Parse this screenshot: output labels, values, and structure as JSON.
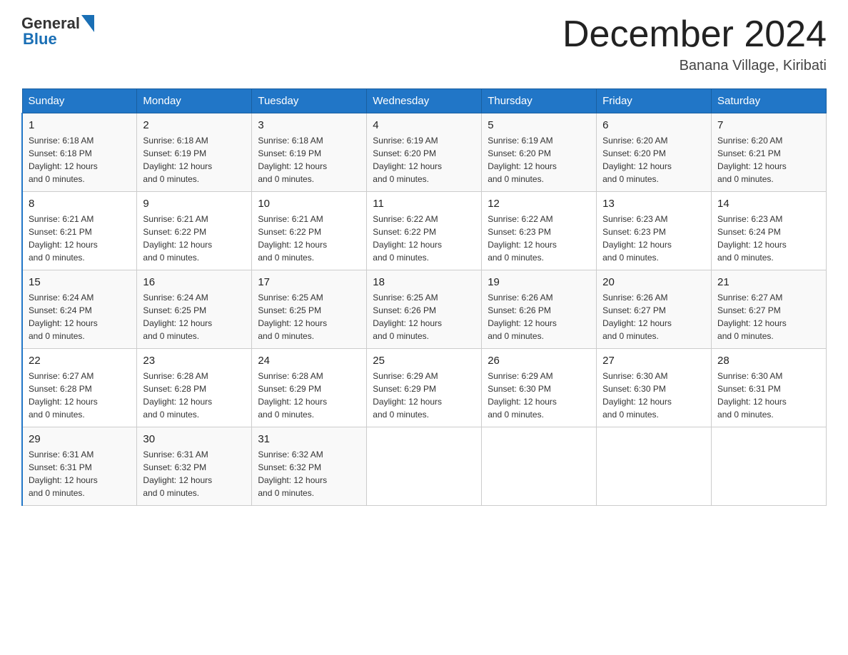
{
  "header": {
    "logo_general": "General",
    "logo_blue": "Blue",
    "month_title": "December 2024",
    "subtitle": "Banana Village, Kiribati"
  },
  "days_of_week": [
    "Sunday",
    "Monday",
    "Tuesday",
    "Wednesday",
    "Thursday",
    "Friday",
    "Saturday"
  ],
  "weeks": [
    [
      {
        "day": "1",
        "sunrise": "6:18 AM",
        "sunset": "6:18 PM",
        "daylight": "12 hours and 0 minutes."
      },
      {
        "day": "2",
        "sunrise": "6:18 AM",
        "sunset": "6:19 PM",
        "daylight": "12 hours and 0 minutes."
      },
      {
        "day": "3",
        "sunrise": "6:18 AM",
        "sunset": "6:19 PM",
        "daylight": "12 hours and 0 minutes."
      },
      {
        "day": "4",
        "sunrise": "6:19 AM",
        "sunset": "6:20 PM",
        "daylight": "12 hours and 0 minutes."
      },
      {
        "day": "5",
        "sunrise": "6:19 AM",
        "sunset": "6:20 PM",
        "daylight": "12 hours and 0 minutes."
      },
      {
        "day": "6",
        "sunrise": "6:20 AM",
        "sunset": "6:20 PM",
        "daylight": "12 hours and 0 minutes."
      },
      {
        "day": "7",
        "sunrise": "6:20 AM",
        "sunset": "6:21 PM",
        "daylight": "12 hours and 0 minutes."
      }
    ],
    [
      {
        "day": "8",
        "sunrise": "6:21 AM",
        "sunset": "6:21 PM",
        "daylight": "12 hours and 0 minutes."
      },
      {
        "day": "9",
        "sunrise": "6:21 AM",
        "sunset": "6:22 PM",
        "daylight": "12 hours and 0 minutes."
      },
      {
        "day": "10",
        "sunrise": "6:21 AM",
        "sunset": "6:22 PM",
        "daylight": "12 hours and 0 minutes."
      },
      {
        "day": "11",
        "sunrise": "6:22 AM",
        "sunset": "6:22 PM",
        "daylight": "12 hours and 0 minutes."
      },
      {
        "day": "12",
        "sunrise": "6:22 AM",
        "sunset": "6:23 PM",
        "daylight": "12 hours and 0 minutes."
      },
      {
        "day": "13",
        "sunrise": "6:23 AM",
        "sunset": "6:23 PM",
        "daylight": "12 hours and 0 minutes."
      },
      {
        "day": "14",
        "sunrise": "6:23 AM",
        "sunset": "6:24 PM",
        "daylight": "12 hours and 0 minutes."
      }
    ],
    [
      {
        "day": "15",
        "sunrise": "6:24 AM",
        "sunset": "6:24 PM",
        "daylight": "12 hours and 0 minutes."
      },
      {
        "day": "16",
        "sunrise": "6:24 AM",
        "sunset": "6:25 PM",
        "daylight": "12 hours and 0 minutes."
      },
      {
        "day": "17",
        "sunrise": "6:25 AM",
        "sunset": "6:25 PM",
        "daylight": "12 hours and 0 minutes."
      },
      {
        "day": "18",
        "sunrise": "6:25 AM",
        "sunset": "6:26 PM",
        "daylight": "12 hours and 0 minutes."
      },
      {
        "day": "19",
        "sunrise": "6:26 AM",
        "sunset": "6:26 PM",
        "daylight": "12 hours and 0 minutes."
      },
      {
        "day": "20",
        "sunrise": "6:26 AM",
        "sunset": "6:27 PM",
        "daylight": "12 hours and 0 minutes."
      },
      {
        "day": "21",
        "sunrise": "6:27 AM",
        "sunset": "6:27 PM",
        "daylight": "12 hours and 0 minutes."
      }
    ],
    [
      {
        "day": "22",
        "sunrise": "6:27 AM",
        "sunset": "6:28 PM",
        "daylight": "12 hours and 0 minutes."
      },
      {
        "day": "23",
        "sunrise": "6:28 AM",
        "sunset": "6:28 PM",
        "daylight": "12 hours and 0 minutes."
      },
      {
        "day": "24",
        "sunrise": "6:28 AM",
        "sunset": "6:29 PM",
        "daylight": "12 hours and 0 minutes."
      },
      {
        "day": "25",
        "sunrise": "6:29 AM",
        "sunset": "6:29 PM",
        "daylight": "12 hours and 0 minutes."
      },
      {
        "day": "26",
        "sunrise": "6:29 AM",
        "sunset": "6:30 PM",
        "daylight": "12 hours and 0 minutes."
      },
      {
        "day": "27",
        "sunrise": "6:30 AM",
        "sunset": "6:30 PM",
        "daylight": "12 hours and 0 minutes."
      },
      {
        "day": "28",
        "sunrise": "6:30 AM",
        "sunset": "6:31 PM",
        "daylight": "12 hours and 0 minutes."
      }
    ],
    [
      {
        "day": "29",
        "sunrise": "6:31 AM",
        "sunset": "6:31 PM",
        "daylight": "12 hours and 0 minutes."
      },
      {
        "day": "30",
        "sunrise": "6:31 AM",
        "sunset": "6:32 PM",
        "daylight": "12 hours and 0 minutes."
      },
      {
        "day": "31",
        "sunrise": "6:32 AM",
        "sunset": "6:32 PM",
        "daylight": "12 hours and 0 minutes."
      },
      null,
      null,
      null,
      null
    ]
  ]
}
